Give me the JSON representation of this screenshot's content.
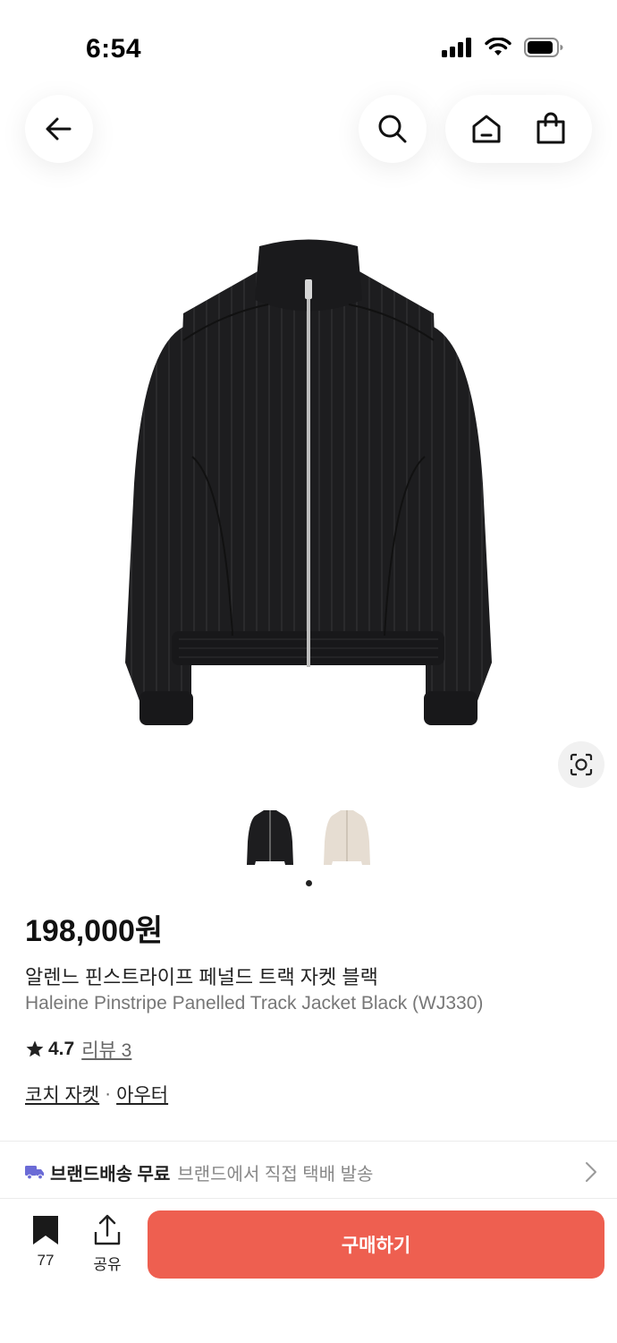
{
  "status_bar": {
    "time": "6:54"
  },
  "nav": {
    "icons": [
      "arrow-left-icon",
      "search-icon",
      "home-icon",
      "shopping-bag-icon"
    ]
  },
  "product": {
    "price": "198,000원",
    "name_ko": "알렌느 핀스트라이프 페널드 트랙 자켓 블랙",
    "name_en": "Haleine Pinstripe Panelled Track Jacket Black (WJ330)",
    "rating": "4.7",
    "reviews": "리뷰 3",
    "category_primary": "코치 자켓",
    "category_separator": "·",
    "category_secondary": "아우터",
    "thumbnails": [
      "black-jacket",
      "beige-jacket"
    ]
  },
  "shipping": {
    "label": "브랜드배송 무료",
    "detail": "브랜드에서 직접 택배 발송"
  },
  "bottom_bar": {
    "save_count": "77",
    "share_label": "공유",
    "buy_label": "구매하기"
  },
  "colors": {
    "buy_button": "#ee5f50",
    "shipping_icon": "#6b6bd6"
  }
}
